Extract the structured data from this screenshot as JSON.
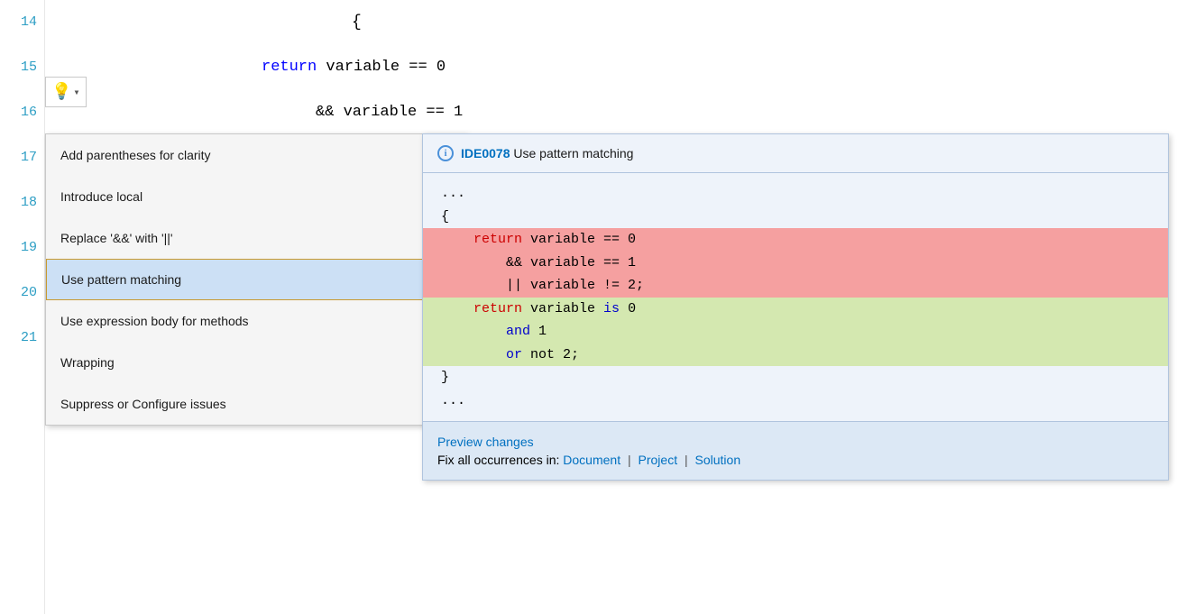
{
  "editor": {
    "lines": [
      {
        "num": "14",
        "code": "    {"
      },
      {
        "num": "15",
        "code": "        return variable == 0"
      },
      {
        "num": "16",
        "code": "            && variable == 1"
      },
      {
        "num": "17",
        "code": ""
      },
      {
        "num": "18",
        "code": ""
      },
      {
        "num": "19",
        "code": ""
      },
      {
        "num": "20",
        "code": ""
      },
      {
        "num": "21",
        "code": ""
      }
    ]
  },
  "lightbulb": {
    "icon": "💡",
    "dropdown_arrow": "▾"
  },
  "context_menu": {
    "items": [
      {
        "label": "Add parentheses for clarity",
        "has_arrow": false
      },
      {
        "label": "Introduce local",
        "has_arrow": true
      },
      {
        "label": "Replace '&&' with '||'",
        "has_arrow": false
      },
      {
        "label": "Use pattern matching",
        "has_arrow": true,
        "selected": true
      },
      {
        "label": "Use expression body for methods",
        "has_arrow": false
      },
      {
        "label": "Wrapping",
        "has_arrow": true
      },
      {
        "label": "Suppress or Configure issues",
        "has_arrow": true
      }
    ]
  },
  "preview": {
    "header": {
      "info_icon": "i",
      "ide_code": "IDE0078",
      "title": "Use pattern matching"
    },
    "code": {
      "before_ellipsis": "...",
      "open_brace": "{",
      "removed": [
        "    return variable == 0",
        "        && variable == 1",
        "        || variable != 2;"
      ],
      "added": [
        "    return variable is 0",
        "        and 1",
        "        or not 2;"
      ],
      "close_brace": "}",
      "after_ellipsis": "..."
    },
    "footer": {
      "preview_label": "Preview changes",
      "fix_label": "Fix all occurrences in:",
      "document": "Document",
      "project": "Project",
      "solution": "Solution",
      "sep1": "|",
      "sep2": "|"
    }
  }
}
